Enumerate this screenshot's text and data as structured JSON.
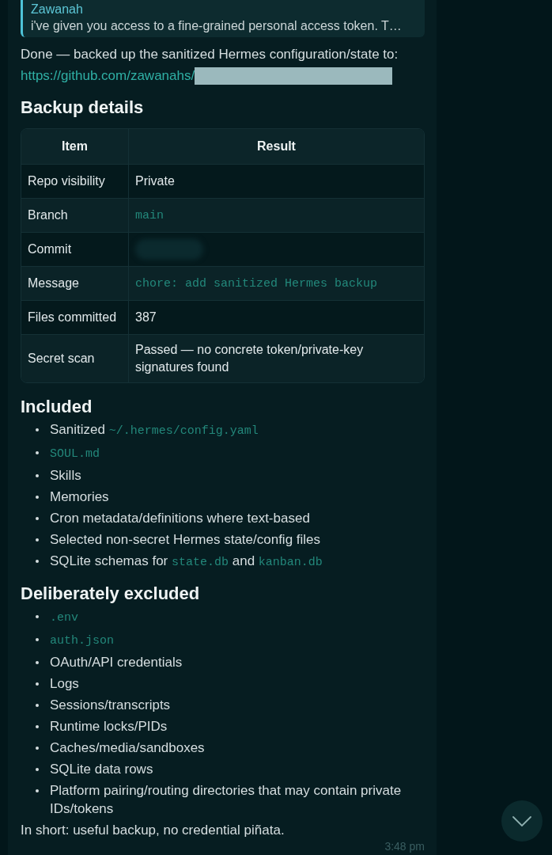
{
  "reply": {
    "author": "Zawanah",
    "text": "i've given you access to a fine-grained personal access token. T…"
  },
  "intro": {
    "text": "Done — backed up the sanitized Hermes configuration/state to:",
    "link": "https://github.com/zawanahs/"
  },
  "details": {
    "heading": "Backup details",
    "columns": [
      "Item",
      "Result"
    ],
    "rows": [
      {
        "item": "Repo visibility",
        "result": [
          {
            "kind": "text",
            "text": "Private"
          }
        ]
      },
      {
        "item": "Branch",
        "result": [
          {
            "kind": "code",
            "text": "main"
          }
        ]
      },
      {
        "item": "Commit",
        "result": [
          {
            "kind": "redacted"
          }
        ]
      },
      {
        "item": "Message",
        "result": [
          {
            "kind": "code",
            "text": "chore: add sanitized Hermes backup"
          }
        ]
      },
      {
        "item": "Files committed",
        "result": [
          {
            "kind": "text",
            "text": "387"
          }
        ]
      },
      {
        "item": "Secret scan",
        "result": [
          {
            "kind": "text",
            "text": "Passed — no concrete token/private-key signatures found"
          }
        ]
      }
    ]
  },
  "included": {
    "heading": "Included",
    "items": [
      {
        "segments": [
          {
            "kind": "text",
            "text": "Sanitized "
          },
          {
            "kind": "code",
            "text": "~/.hermes/config.yaml"
          }
        ]
      },
      {
        "segments": [
          {
            "kind": "code",
            "text": "SOUL.md"
          }
        ]
      },
      {
        "segments": [
          {
            "kind": "text",
            "text": "Skills"
          }
        ]
      },
      {
        "segments": [
          {
            "kind": "text",
            "text": "Memories"
          }
        ]
      },
      {
        "segments": [
          {
            "kind": "text",
            "text": "Cron metadata/definitions where text-based"
          }
        ]
      },
      {
        "segments": [
          {
            "kind": "text",
            "text": "Selected non-secret Hermes state/config files"
          }
        ]
      },
      {
        "segments": [
          {
            "kind": "text",
            "text": "SQLite schemas for "
          },
          {
            "kind": "code",
            "text": "state.db"
          },
          {
            "kind": "text",
            "text": " and "
          },
          {
            "kind": "code",
            "text": "kanban.db"
          }
        ]
      }
    ]
  },
  "excluded": {
    "heading": "Deliberately excluded",
    "items": [
      {
        "segments": [
          {
            "kind": "code",
            "text": ".env"
          }
        ]
      },
      {
        "segments": [
          {
            "kind": "code",
            "text": "auth.json"
          }
        ]
      },
      {
        "segments": [
          {
            "kind": "text",
            "text": "OAuth/API credentials"
          }
        ]
      },
      {
        "segments": [
          {
            "kind": "text",
            "text": "Logs"
          }
        ]
      },
      {
        "segments": [
          {
            "kind": "text",
            "text": "Sessions/transcripts"
          }
        ]
      },
      {
        "segments": [
          {
            "kind": "text",
            "text": "Runtime locks/PIDs"
          }
        ]
      },
      {
        "segments": [
          {
            "kind": "text",
            "text": "Caches/media/sandboxes"
          }
        ]
      },
      {
        "segments": [
          {
            "kind": "text",
            "text": "SQLite data rows"
          }
        ]
      },
      {
        "segments": [
          {
            "kind": "text",
            "text": "Platform pairing/routing directories that may contain private IDs/tokens"
          }
        ]
      }
    ]
  },
  "summary": "In short: useful backup, no credential piñata.",
  "time": "3:48 pm"
}
